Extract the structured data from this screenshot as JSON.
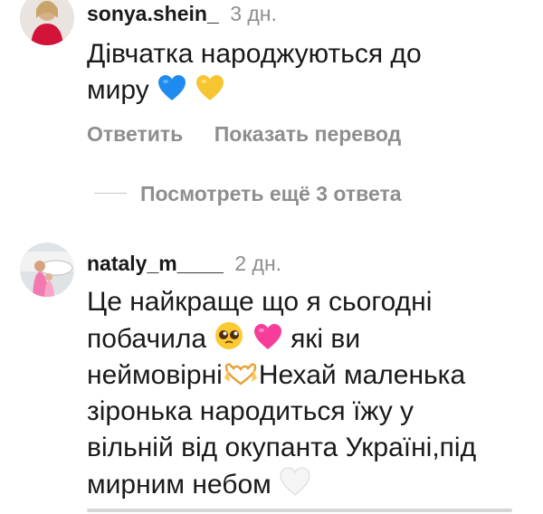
{
  "comments": [
    {
      "username": "sonya.shein_",
      "time": "3 дн.",
      "text_line1": "Дівчатка народжуються до",
      "text_line2": "миру",
      "emojis": [
        "blue-heart",
        "yellow-heart"
      ],
      "reply_label": "Ответить",
      "translate_label": "Показать перевод",
      "view_replies_label": "Посмотреть ещё 3 ответа"
    },
    {
      "username": "nataly_m____",
      "time": "2 дн.",
      "text_line1": "Це найкраще що я сьогодні",
      "text_line2a": "побачила",
      "text_line2b": "які ви",
      "text_line3a": "неймовірні",
      "text_line3b": "Нехай маленька",
      "text_line4": "зіронька народиться їжу у",
      "text_line5": "вільній від окупанта Україні,під",
      "text_line6": "мирним небом",
      "emojis": [
        "pleading-face",
        "pink-heart",
        "heart-hands",
        "white-heart"
      ]
    }
  ],
  "colors": {
    "text": "#1a1a1a",
    "secondary": "#8e8e8e",
    "blue_heart": "#1f8bf0",
    "yellow_heart": "#f7c532",
    "pink_heart": "#f73c9a",
    "white_heart": "#eeeeee"
  }
}
